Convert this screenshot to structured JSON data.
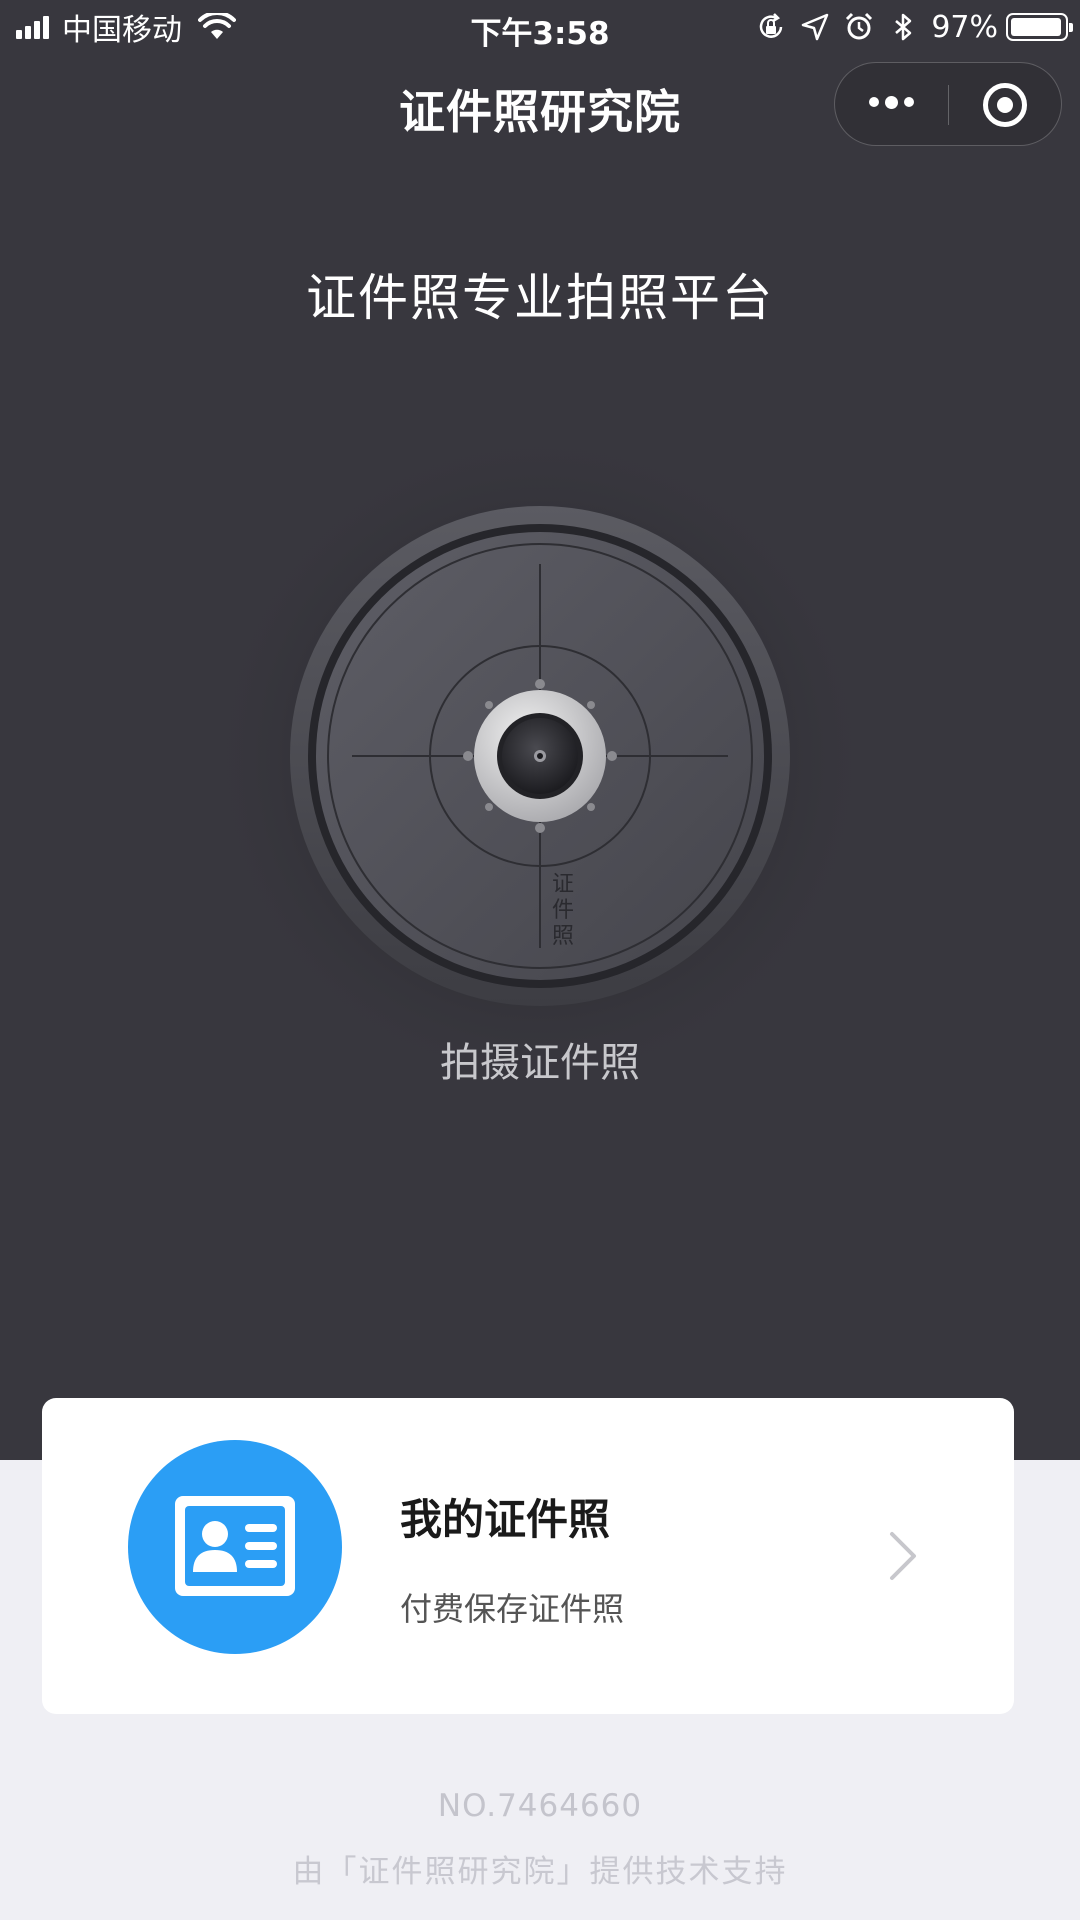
{
  "status_bar": {
    "carrier": "中国移动",
    "time": "下午3:58",
    "battery": "97%",
    "battery_level": 0.97,
    "icons": [
      "signal-icon",
      "wifi-icon",
      "orientation-lock-icon",
      "location-icon",
      "alarm-icon",
      "bluetooth-icon",
      "battery-icon"
    ]
  },
  "nav": {
    "title": "证件照研究院",
    "more_icon": "more-dots-icon",
    "close_icon": "target-close-icon"
  },
  "main": {
    "headline": "证件照专业拍照平台",
    "dial_text": [
      "证",
      "件",
      "照"
    ],
    "shoot_label": "拍摄证件照"
  },
  "card": {
    "icon": "id-card-icon",
    "title": "我的证件照",
    "subtitle": "付费保存证件照",
    "icon_color": "#2b9ef5"
  },
  "footer": {
    "number": "NO.7464660",
    "support": "由「证件照研究院」提供技术支持"
  },
  "colors": {
    "dark_bg": "#38373e",
    "light_bg": "#efeff4",
    "accent": "#2b9ef5"
  }
}
